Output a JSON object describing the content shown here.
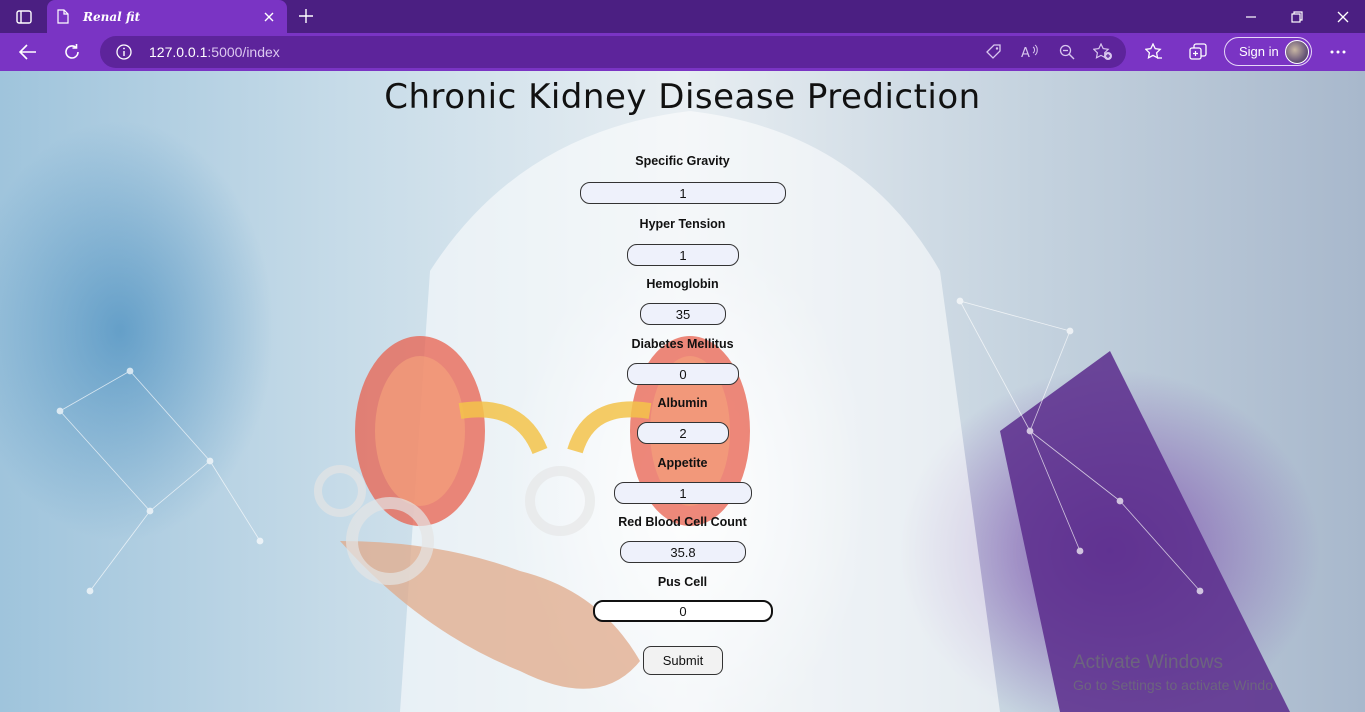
{
  "browser": {
    "tab_title": "Renal fit",
    "url_host": "127.0.0.1",
    "url_path": ":5000/index",
    "signin_label": "Sign in"
  },
  "page": {
    "heading": "Chronic Kidney Disease Prediction",
    "fields": [
      {
        "label": "Specific Gravity",
        "value": "1"
      },
      {
        "label": "Hyper Tension",
        "value": "1"
      },
      {
        "label": "Hemoglobin",
        "value": "35"
      },
      {
        "label": "Diabetes Mellitus",
        "value": "0"
      },
      {
        "label": "Albumin",
        "value": "2"
      },
      {
        "label": "Appetite",
        "value": "1"
      },
      {
        "label": "Red Blood Cell Count",
        "value": "35.8"
      },
      {
        "label": "Pus Cell",
        "value": "0"
      }
    ],
    "submit_label": "Submit"
  },
  "watermark": {
    "line1": "Activate Windows",
    "line2": "Go to Settings to activate Windo"
  },
  "icons": {
    "tab_actions": "tab-actions-icon",
    "page_favicon": "page-icon",
    "close_tab": "close-icon",
    "new_tab": "plus-icon",
    "back": "back-arrow-icon",
    "refresh": "refresh-icon",
    "site_info": "info-icon",
    "tracking": "tag-icon",
    "read_aloud": "read-aloud-icon",
    "zoom_out": "zoom-out-icon",
    "add_favorite": "star-add-icon",
    "favorites": "favorites-icon",
    "collections": "collections-icon",
    "menu": "more-icon"
  },
  "colors": {
    "titlebar": "#4b1f82",
    "toolbar": "#7a34c4",
    "addressbar": "#5d249b"
  }
}
